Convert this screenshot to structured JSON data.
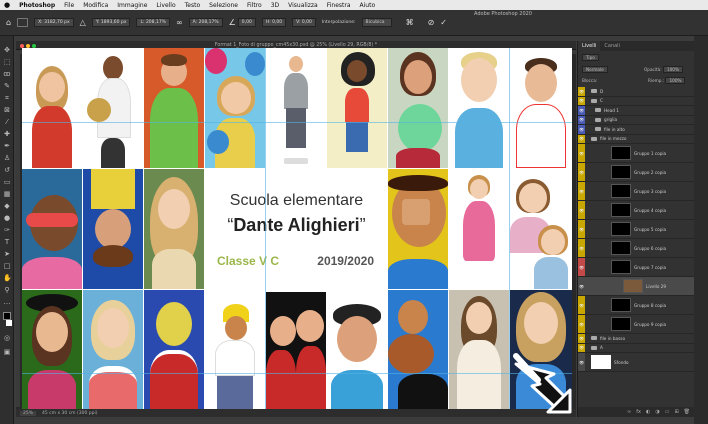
{
  "menubar": {
    "apple": "",
    "app": "Photoshop",
    "items": [
      "File",
      "Modifica",
      "Immagine",
      "Livello",
      "Testo",
      "Selezione",
      "Filtro",
      "3D",
      "Visualizza",
      "Finestra",
      "Aiuto"
    ]
  },
  "options": {
    "x": "X: 3182,70 px",
    "y": "Y: 1893,60 px",
    "w": "L: 208,17%",
    "h": "A: 208,17%",
    "angle": "0,00",
    "hskew": "H: 0,00",
    "vskew": "V: 0,00",
    "interp_label": "Interpolazione:",
    "interp_value": "Bicubica",
    "cancel": "⊘",
    "commit": "✓"
  },
  "app_title": "Adobe Photoshop 2020",
  "document": {
    "title": "Format 1_Foto di gruppo_cm45x30.psd @ 25% (Livello 29, RGB/8) *",
    "zoom": "25%",
    "size": "45 cm x 30 cm (300 ppi)"
  },
  "canvas": {
    "line1": "Scuola elementare",
    "line2_open": "“",
    "line2": "Dante Alighieri",
    "line2_close": "”",
    "class": "Classe V C",
    "year": "2019/2020"
  },
  "panels": {
    "tabs": [
      "Livelli",
      "Canali"
    ],
    "search_placeholder": "Tipo",
    "blend_mode": "Normale",
    "opacity_label": "Opacità:",
    "opacity": "100%",
    "fill_label": "Riemp.:",
    "fill": "100%",
    "lock_label": "Blocca:",
    "layers": [
      {
        "name": "D",
        "color": "#c8a800",
        "type": "folder"
      },
      {
        "name": "C",
        "color": "#c8a800",
        "type": "folder"
      },
      {
        "name": "Head 1",
        "color": "#4a5bb5",
        "type": "folder"
      },
      {
        "name": "griglia",
        "color": "#4a5bb5",
        "type": "folder"
      },
      {
        "name": "file in alto",
        "color": "#4a5bb5",
        "type": "folder"
      },
      {
        "name": "file in mezzo",
        "color": "#c8a800",
        "type": "folder"
      },
      {
        "name": "Gruppo 1 copia",
        "color": "#c8a800",
        "type": "group"
      },
      {
        "name": "Gruppo 2 copia",
        "color": "#c8a800",
        "type": "group"
      },
      {
        "name": "Gruppo 3 copia",
        "color": "#c8a800",
        "type": "group"
      },
      {
        "name": "Gruppo 4 copia",
        "color": "#c8a800",
        "type": "group"
      },
      {
        "name": "Gruppo 5 copia",
        "color": "#c8a800",
        "type": "group"
      },
      {
        "name": "Gruppo 6 copia",
        "color": "#c8a800",
        "type": "group"
      },
      {
        "name": "Gruppo 7 copia",
        "color": "#c44a4a",
        "type": "group"
      },
      {
        "name": "Livello 29",
        "color": "#4a4a4a",
        "type": "layer"
      },
      {
        "name": "Gruppo 8 copia",
        "color": "#c8a800",
        "type": "group"
      },
      {
        "name": "Gruppo 9 copia",
        "color": "#c8a800",
        "type": "group"
      },
      {
        "name": "file in basso",
        "color": "#c8a800",
        "type": "folder"
      },
      {
        "name": "A",
        "color": "#c8a800",
        "type": "folder"
      },
      {
        "name": "Sfondo",
        "color": "#4a4a4a",
        "type": "background"
      }
    ],
    "bottom_icons": [
      "link-icon",
      "fx-icon",
      "mask-icon",
      "adjustment-icon",
      "folder-icon",
      "new-layer-icon",
      "trash-icon"
    ]
  }
}
